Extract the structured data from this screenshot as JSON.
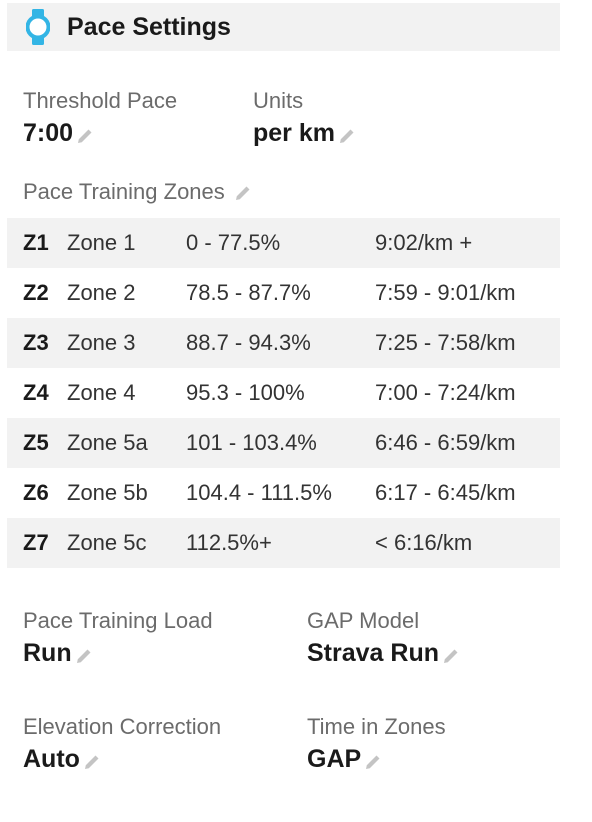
{
  "header": {
    "title": "Pace Settings",
    "icon": "watch-icon",
    "accent": "#33b5e5"
  },
  "settings": {
    "threshold_pace": {
      "label": "Threshold Pace",
      "value": "7:00"
    },
    "units": {
      "label": "Units",
      "value": "per km"
    }
  },
  "zones_title": "Pace Training Zones",
  "zones": [
    {
      "id": "Z1",
      "name": "Zone 1",
      "range": "0 - 77.5%",
      "pace": "9:02/km +"
    },
    {
      "id": "Z2",
      "name": "Zone 2",
      "range": "78.5 - 87.7%",
      "pace": "7:59 - 9:01/km"
    },
    {
      "id": "Z3",
      "name": "Zone 3",
      "range": "88.7 - 94.3%",
      "pace": "7:25 - 7:58/km"
    },
    {
      "id": "Z4",
      "name": "Zone 4",
      "range": "95.3 - 100%",
      "pace": "7:00 - 7:24/km"
    },
    {
      "id": "Z5",
      "name": "Zone 5a",
      "range": "101 - 103.4%",
      "pace": "6:46 - 6:59/km"
    },
    {
      "id": "Z6",
      "name": "Zone 5b",
      "range": "104.4 - 111.5%",
      "pace": "6:17 - 6:45/km"
    },
    {
      "id": "Z7",
      "name": "Zone 5c",
      "range": "112.5%+",
      "pace": "< 6:16/km"
    }
  ],
  "bottom_settings": {
    "training_load": {
      "label": "Pace Training Load",
      "value": "Run"
    },
    "gap_model": {
      "label": "GAP Model",
      "value": "Strava Run"
    },
    "elevation_correction": {
      "label": "Elevation Correction",
      "value": "Auto"
    },
    "time_in_zones": {
      "label": "Time in Zones",
      "value": "GAP"
    }
  }
}
